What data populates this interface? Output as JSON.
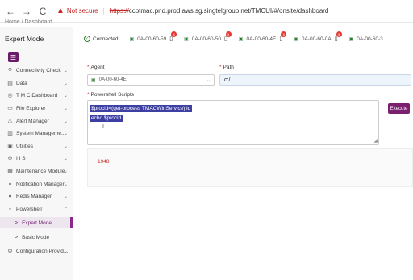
{
  "browser": {
    "back": "←",
    "forward": "→",
    "reload": "C",
    "warn_icon": "▲",
    "not_secure": "Not secure",
    "https": "https://",
    "url_rest": "ccptmac.pnd.prod.aws.sg.singtelgroup.net/TMCUI/#/onsite/dashboard"
  },
  "breadcrumb": "Home / Dashboard",
  "sidebar": {
    "title": "Expert Mode",
    "toggle_icon": "☰",
    "items": [
      {
        "icon": "⚲",
        "label": "Connectivity Check",
        "chev": "⌄"
      },
      {
        "icon": "▤",
        "label": "Data",
        "chev": "⌄"
      },
      {
        "icon": "◎",
        "label": "T M C Dashboard",
        "chev": "⌄"
      },
      {
        "icon": "▭",
        "label": "File Explorer",
        "chev": "⌄"
      },
      {
        "icon": "⚠",
        "label": "Alert Manager",
        "chev": "⌄"
      },
      {
        "icon": "▥",
        "label": "System Manageme...",
        "chev": "⌄"
      },
      {
        "icon": "▣",
        "label": "Utilities",
        "chev": "⌄"
      },
      {
        "icon": "⊕",
        "label": "I I S",
        "chev": "⌄"
      },
      {
        "icon": "▦",
        "label": "Maintenance Module",
        "chev": "⌄"
      },
      {
        "icon": "♦",
        "label": "Notification Manager",
        "chev": "⌄"
      },
      {
        "icon": "●",
        "label": "Redis Manager",
        "chev": "⌄"
      },
      {
        "icon": "▪",
        "label": "Powershell",
        "chev": "⌃"
      }
    ],
    "sub_items": [
      {
        "arrow": ">",
        "label": "Expert Mode"
      },
      {
        "arrow": ">",
        "label": "Basic Mode"
      }
    ],
    "last_item": {
      "icon": "⚙",
      "label": "Configuration Provid...",
      "chev": "⌄"
    }
  },
  "topbar": {
    "connected_icon": "✓",
    "connected": "Connected",
    "agents": [
      {
        "id": "0A-00-60-59",
        "badge": "x"
      },
      {
        "id": "0A-00-60-50",
        "badge": "x"
      },
      {
        "id": "0A-00-60-4E",
        "badge": "x"
      },
      {
        "id": "0A-00-60-0A",
        "badge": "x"
      },
      {
        "id": "0A-00-60-3..."
      }
    ],
    "agent_icon": "▣",
    "phone_icon": "▯"
  },
  "form": {
    "agent_label": "Agent",
    "path_label": "Path",
    "required_mark": "*",
    "agent_value": "0A-00-60-4E",
    "path_value": "c:/",
    "scripts_label": "Powershell Scripts",
    "script_line1": "$procid=(get-process TMACWinService).id",
    "script_line2": "echo $procid",
    "cursor": "I",
    "resize": "◢",
    "execute_label": "Execute"
  },
  "output": {
    "text": "1948"
  },
  "colors": {
    "accent": "#7b1f6f",
    "selection": "#3d3fa3",
    "connected_green": "#2e7d32",
    "error_red": "#c62828"
  }
}
